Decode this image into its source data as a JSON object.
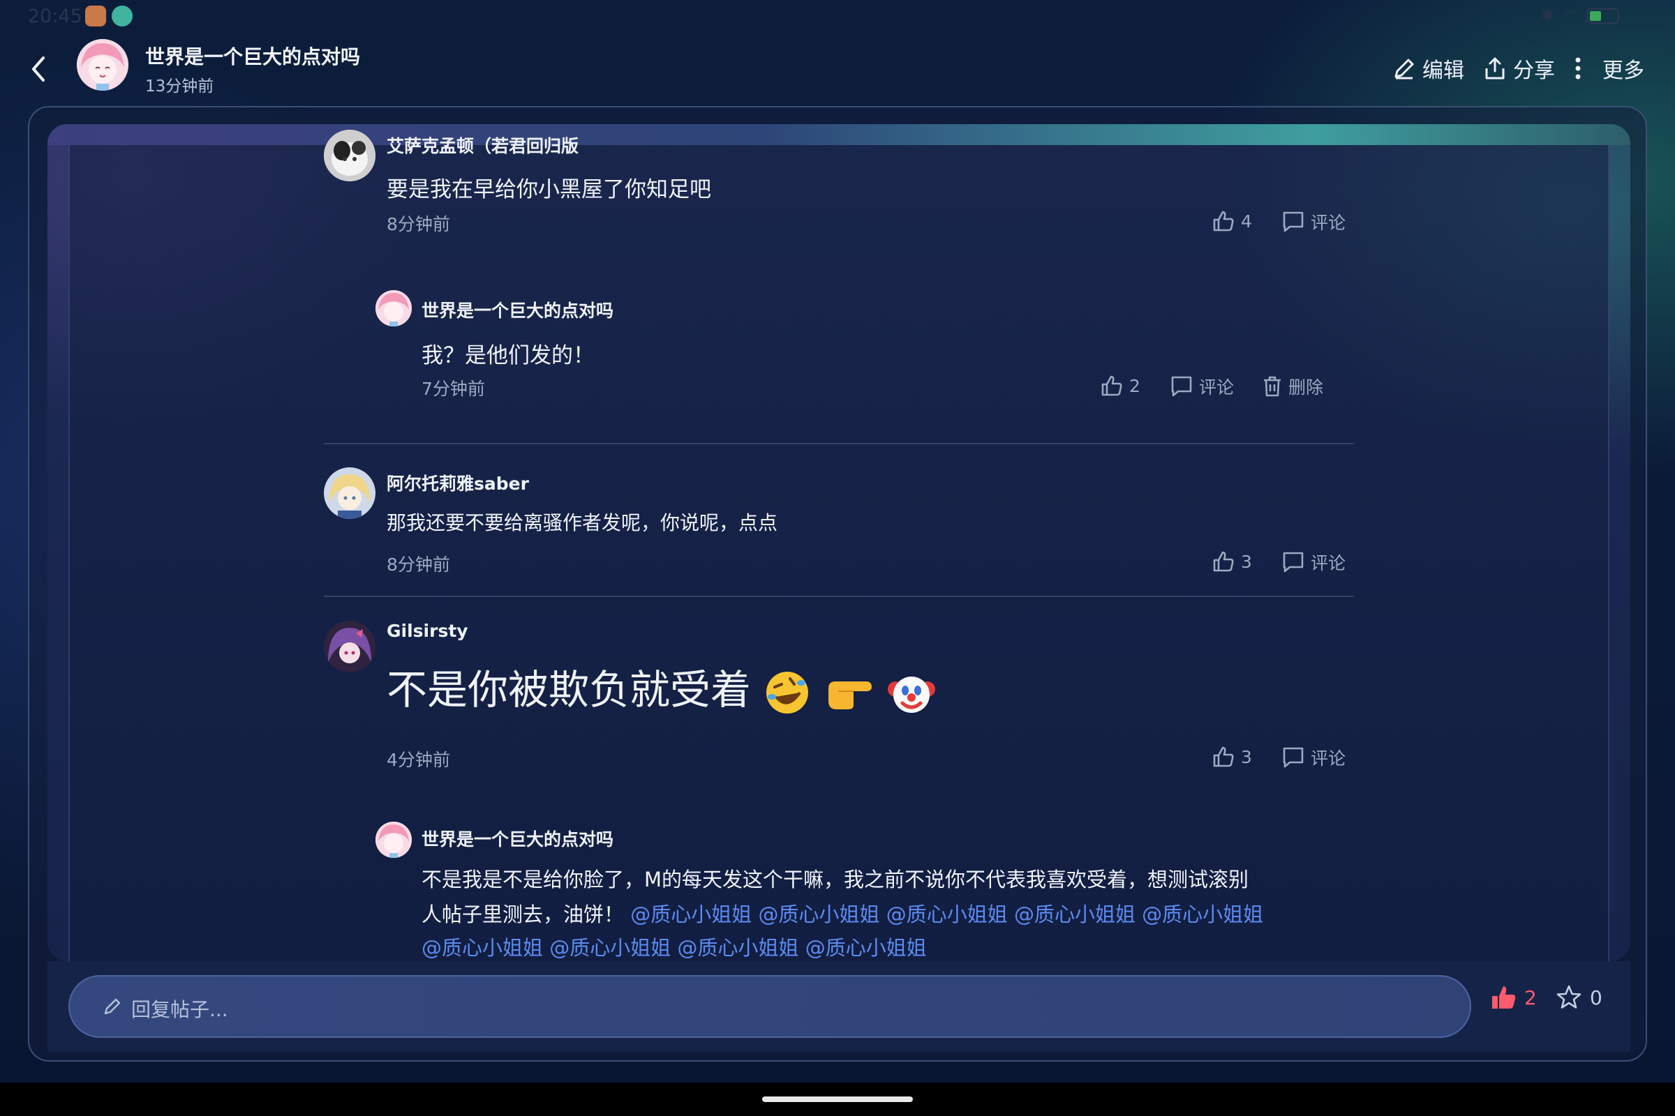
{
  "status": {
    "time": "20:45"
  },
  "header": {
    "title": "世界是一个巨大的点对吗",
    "time": "13分钟前",
    "edit_label": "编辑",
    "share_label": "分享",
    "more_label": "更多"
  },
  "comments": [
    {
      "user": "艾萨克孟顿（若君回归版",
      "text": "要是我在早给你小黑屋了你知足吧",
      "time": "8分钟前",
      "likes": "4",
      "comment_label": "评论",
      "reply": {
        "user": "世界是一个巨大的点对吗",
        "text": "我？是他们发的！",
        "time": "7分钟前",
        "likes": "2",
        "comment_label": "评论",
        "delete_label": "删除"
      }
    },
    {
      "user": "阿尔托莉雅saber",
      "text": "那我还要不要给离骚作者发呢，你说呢，点点",
      "time": "8分钟前",
      "likes": "3",
      "comment_label": "评论"
    },
    {
      "user": "Gilsirsty",
      "text": "不是你被欺负就受着",
      "emojis": [
        "rofl-emoji",
        "pointing-right-emoji",
        "clown-emoji"
      ],
      "time": "4分钟前",
      "likes": "3",
      "comment_label": "评论",
      "reply": {
        "user": "世界是一个巨大的点对吗",
        "text_line1": "不是我是不是给你脸了，M的每天发这个干嘛，我之前不说你不代表我喜欢受着，想测试滚别",
        "text_line2": "人帖子里测去，油饼！",
        "mention": "@质心小姐姐"
      }
    }
  ],
  "reply_bar": {
    "placeholder": "回复帖子...",
    "likes": "2",
    "stars": "0"
  },
  "colors": {
    "accent_like": "#ff5a6e",
    "mention": "#5c8bf0"
  }
}
